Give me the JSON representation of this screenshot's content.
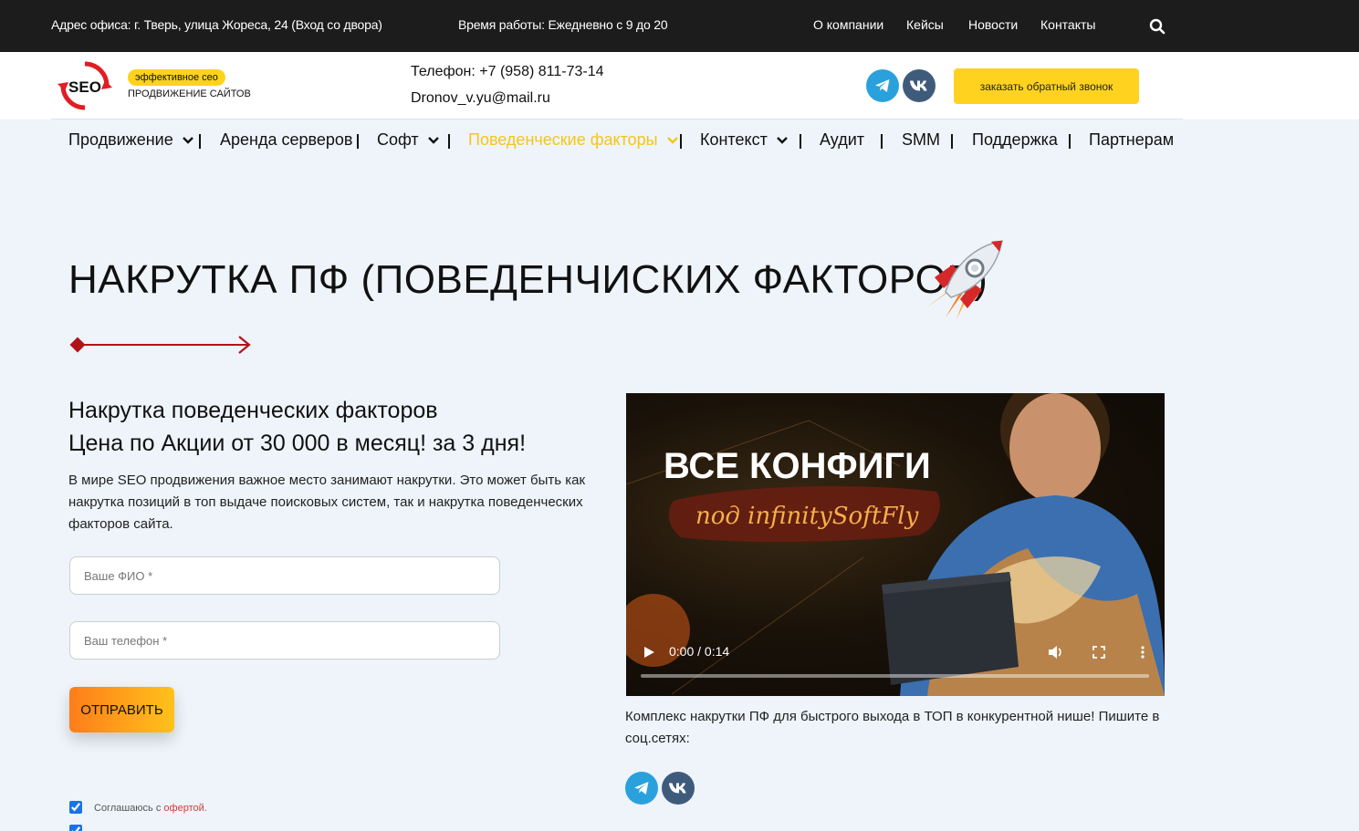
{
  "topbar": {
    "address": "Адрес офиса: г. Тверь, улица Жореса, 24 (Вход со двора)",
    "hours": "Время работы: Ежедневно с 9 до 20",
    "links": [
      "О компании",
      "Кейсы",
      "Новости",
      "Контакты"
    ]
  },
  "header": {
    "logo_text": "SEO",
    "badge": "эффективное сео",
    "logo_sub": "ПРОДВИЖЕНИЕ САЙТОВ",
    "phone": "Телефон: +7 (958) 811-73-14",
    "email": "Dronov_v.yu@mail.ru",
    "callback_label": "заказать обратный звонок"
  },
  "mainnav": {
    "items": [
      {
        "label": "Продвижение",
        "dropdown": true
      },
      {
        "label": "Аренда серверов",
        "dropdown": false
      },
      {
        "label": "Софт",
        "dropdown": true
      },
      {
        "label": "Поведенческие факторы",
        "dropdown": true,
        "active": true
      },
      {
        "label": "Контекст",
        "dropdown": true
      },
      {
        "label": "Аудит",
        "dropdown": false
      },
      {
        "label": "SMM",
        "dropdown": false
      },
      {
        "label": "Поддержка",
        "dropdown": false
      },
      {
        "label": "Партнерам",
        "dropdown": false
      }
    ]
  },
  "hero": {
    "title": "НАКРУТКА ПФ (ПОВЕДЕНЧИСКИХ ФАКТОРОВ)",
    "subtitle_line1": "Накрутка поведенческих факторов",
    "subtitle_line2": "Цена по Акции от 30 000 в месяц! за 3 дня!",
    "intro": "В мире SEO продвижения важное место занимают накрутки. Это может быть как накрутка позиций в топ выдаче поисковых систем, так и накрутка поведенческих факторов сайта."
  },
  "form": {
    "name_placeholder": "Ваше ФИО *",
    "phone_placeholder": "Ваш телефон *",
    "submit_label": "ОТПРАВИТЬ",
    "consent_text": "Соглашаюсь с ",
    "consent_link": "офертой."
  },
  "video": {
    "title": "ВСЕ КОНФИГИ",
    "script": "под infinitySoftFly",
    "time": "0:00 / 0:14",
    "progress": 0
  },
  "caption": "Комплекс накрутки ПФ для быстрого выхода в ТОП в конкурентной нише! Пишите в соц.сетях:",
  "colors": {
    "accent_yellow": "#ffd21f",
    "active_nav": "#f5c518",
    "telegram": "#2aa1dd",
    "vk": "#3f5b7c",
    "arrow_red": "#b3121b"
  }
}
